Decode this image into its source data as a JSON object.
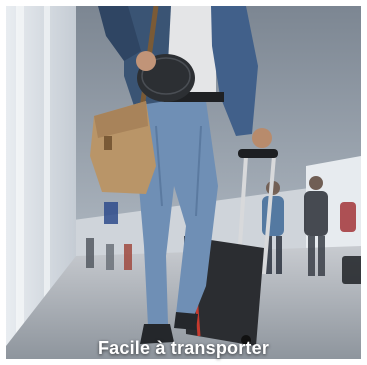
{
  "caption": "Facile à transporter",
  "colors": {
    "jeans": "#6f8fb5",
    "jacket": "#3a5474",
    "satchel": "#b99568",
    "case_body": "#2b2d31",
    "case_trim": "#c63a2e",
    "pouch": "#2c2f33",
    "caption_text": "#ffffff"
  },
  "icons": [
    "walking-traveler",
    "rolling-suitcase",
    "leather-satchel",
    "travel-pouch"
  ]
}
